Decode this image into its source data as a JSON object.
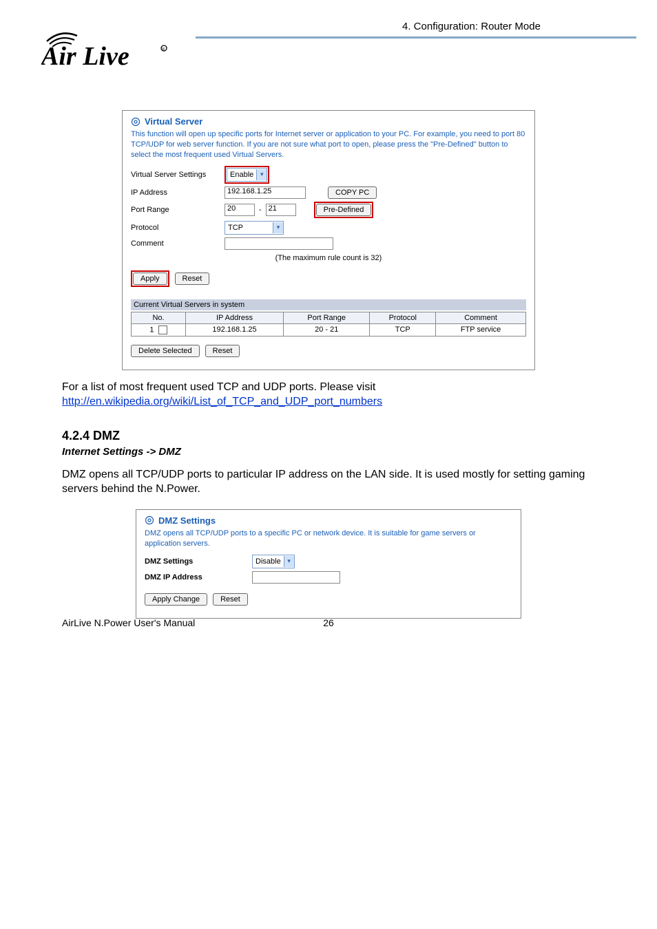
{
  "header": {
    "breadcrumb": "4.  Configuration:  Router  Mode",
    "logo_text": "AirLive"
  },
  "virtual_server": {
    "title": "Virtual Server",
    "description": "This function will open up specific ports for Internet server or application to your PC. For example, you need to port 80 TCP/UDP for web server function. If you are not sure what port to open, please press the \"Pre-Defined\" button to select the most frequent used Virtual Servers.",
    "rows": {
      "settings_label": "Virtual Server Settings",
      "settings_value": "Enable",
      "ip_label": "IP Address",
      "ip_value": "192.168.1.25",
      "copy_pc": "COPY PC",
      "port_label": "Port Range",
      "port_from": "20",
      "port_to": "21",
      "pre_defined": "Pre-Defined",
      "protocol_label": "Protocol",
      "protocol_value": "TCP",
      "comment_label": "Comment",
      "comment_value": ""
    },
    "max_note": "(The maximum rule count is 32)",
    "apply": "Apply",
    "reset": "Reset",
    "table_caption": "Current Virtual Servers in system",
    "columns": [
      "No.",
      "IP Address",
      "Port Range",
      "Protocol",
      "Comment"
    ],
    "data_row": {
      "no": "1",
      "ip": "192.168.1.25",
      "range": "20 - 21",
      "protocol": "TCP",
      "comment": "FTP service"
    },
    "delete_selected": "Delete Selected",
    "reset2": "Reset"
  },
  "after_panel": {
    "line1": "For a list of most frequent used TCP and UDP ports. Please visit",
    "link": "http://en.wikipedia.org/wiki/List_of_TCP_and_UDP_port_numbers"
  },
  "section": {
    "num_title": "4.2.4 DMZ",
    "sub": "Internet Settings -> DMZ",
    "para": "DMZ opens all TCP/UDP ports to particular IP address on the LAN side.    It is used mostly for setting gaming servers behind the N.Power."
  },
  "dmz": {
    "title": "DMZ Settings",
    "description": "DMZ opens all TCP/UDP ports to a specific PC or network device. It is suitable for game servers or application servers.",
    "settings_label": "DMZ Settings",
    "settings_value": "Disable",
    "ip_label": "DMZ IP Address",
    "ip_value": "",
    "apply": "Apply Change",
    "reset": "Reset"
  },
  "footer": {
    "left": "AirLive N.Power User's Manual",
    "page": "26"
  }
}
